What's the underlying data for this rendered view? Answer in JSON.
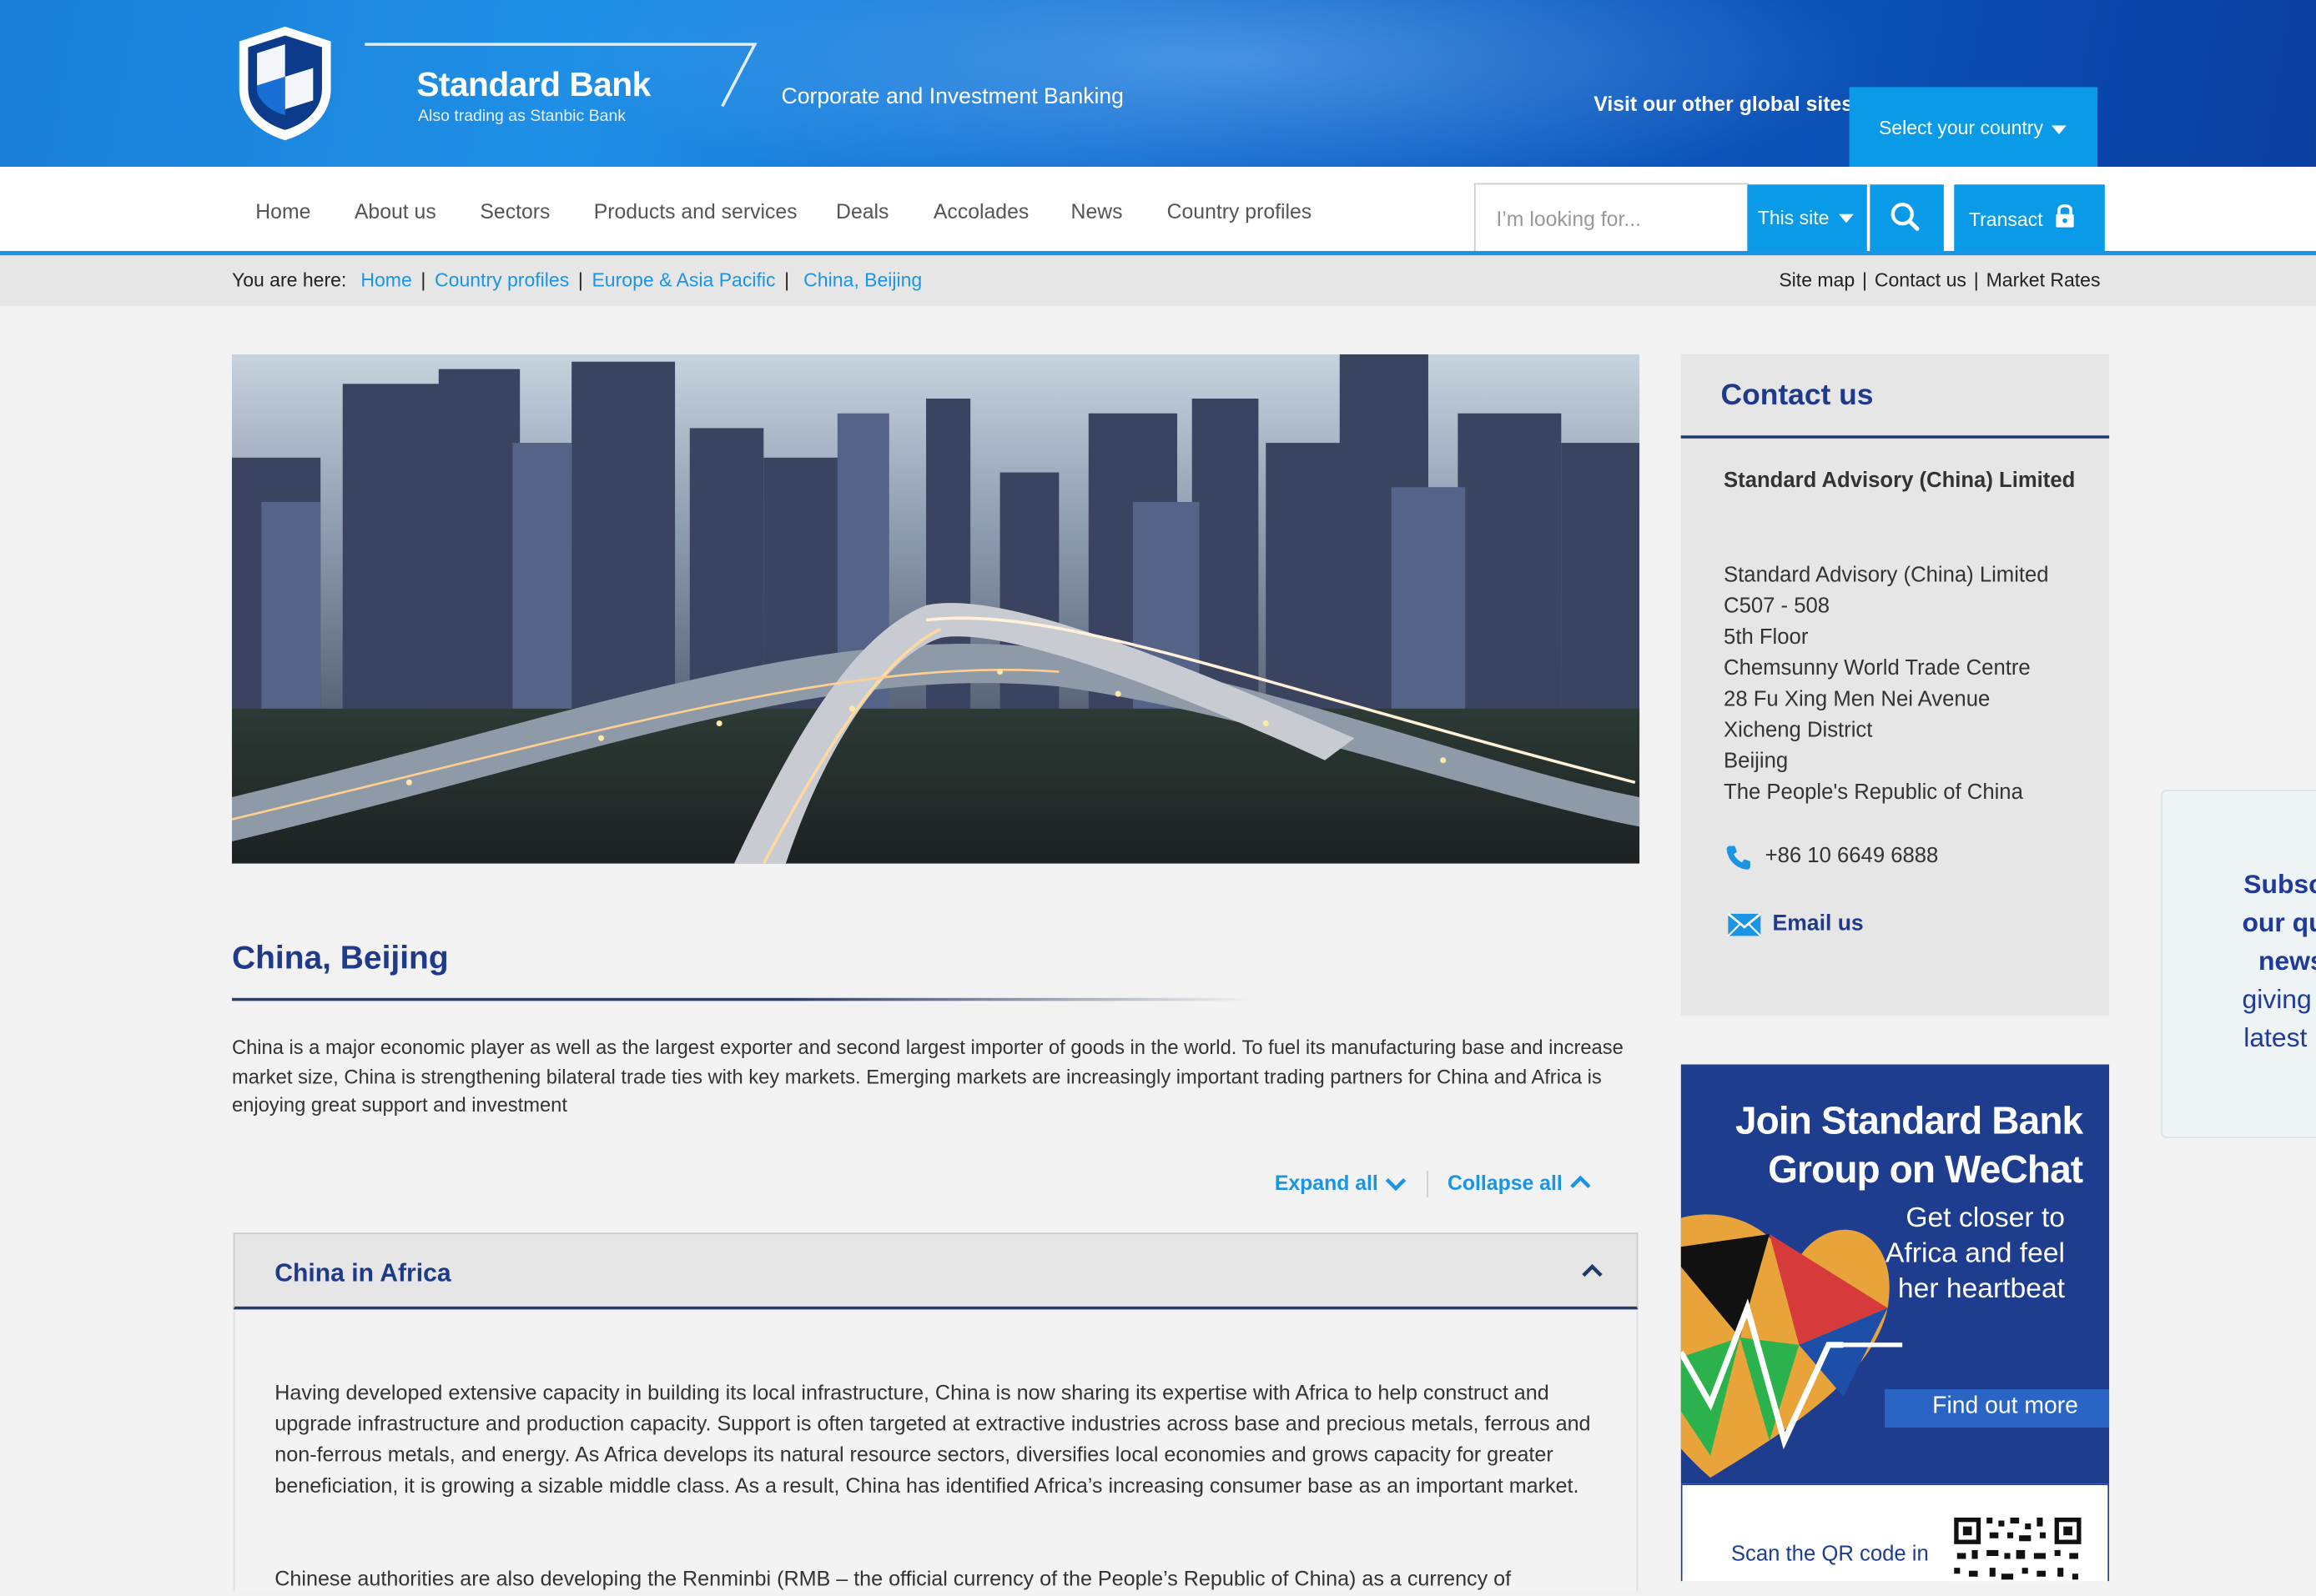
{
  "header": {
    "brand_name": "Standard Bank",
    "brand_sub": "Also trading as Stanbic Bank",
    "tagline": "Corporate and Investment Banking",
    "visit_label": "Visit our other global sites",
    "country_select": "Select your country"
  },
  "nav": {
    "items": [
      "Home",
      "About us",
      "Sectors",
      "Products and services",
      "Deals",
      "Accolades",
      "News",
      "Country profiles"
    ],
    "search_placeholder": "I’m looking for...",
    "scope": "This site",
    "transact": "Transact"
  },
  "breadcrumb": {
    "label": "You are here:",
    "items": [
      "Home",
      "Country profiles",
      "Europe & Asia Pacific",
      "China, Beijing"
    ]
  },
  "utility_links": [
    "Site map",
    "Contact us",
    "Market Rates"
  ],
  "main": {
    "title": "China, Beijing",
    "intro": "China is a major economic player as well as the largest exporter and second largest importer of goods in the world. To fuel its manufacturing base and increase market size, China is strengthening bilateral trade ties with key markets. Emerging markets are increasingly important trading partners for China and Africa is enjoying great support and investment",
    "expand_all": "Expand all",
    "collapse_all": "Collapse all",
    "accordion": {
      "title": "China in Africa",
      "paragraphs": [
        "Having developed extensive capacity in building its local infrastructure, China is now sharing its expertise with Africa to help construct and upgrade infrastructure and production capacity. Support is often targeted at extractive industries across base and precious metals, ferrous and non-ferrous metals, and energy. As Africa develops its natural resource sectors, diversifies local economies and grows capacity for greater beneficiation, it is growing a sizable middle class. As a result, China has identified Africa’s increasing consumer base as an important market.",
        "Chinese authorities are also developing the Renminbi (RMB – the official currency of the People’s Republic of China) as a currency of"
      ]
    }
  },
  "contact": {
    "title": "Contact us",
    "org": "Standard Advisory (China) Limited",
    "address": [
      "Standard Advisory (China) Limited",
      "C507 - 508",
      "5th Floor",
      "Chemsunny World Trade Centre",
      "28 Fu Xing Men Nei Avenue",
      "Xicheng District",
      "Beijing",
      "The People's Republic of China"
    ],
    "phone": "+86 10 6649 6888",
    "email_label": "Email us"
  },
  "wechat_promo": {
    "title_line1": "Join Standard Bank",
    "title_line2": "Group on WeChat",
    "sub_lines": [
      "Get closer to",
      "Africa and feel",
      "her heartbeat"
    ],
    "cta": "Find out more",
    "scan_text": "Scan the QR code in"
  },
  "subscribe_panel": {
    "lines": [
      "Subsc",
      "our qu",
      "news",
      "giving",
      "latest"
    ]
  },
  "colors": {
    "brand_blue": "#1f3a8a",
    "link_blue": "#1a95e6",
    "button_blue": "#0a9be8"
  }
}
